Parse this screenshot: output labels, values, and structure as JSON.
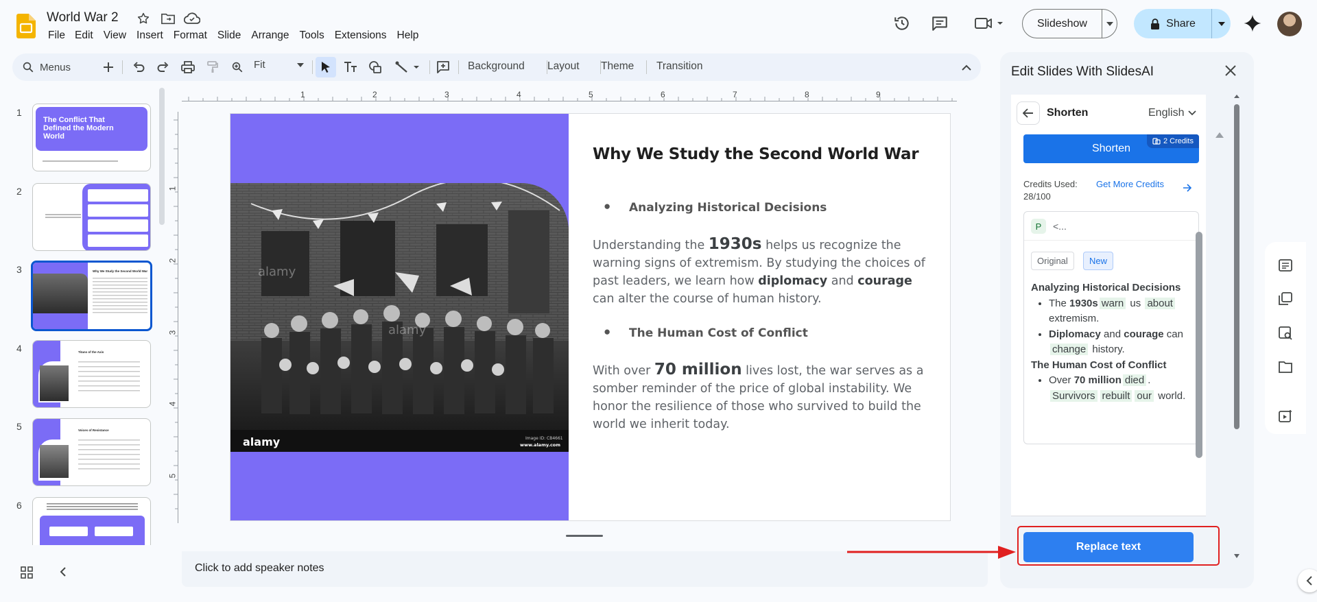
{
  "app": {
    "doc_title": "World War 2",
    "menu": [
      "File",
      "Edit",
      "View",
      "Insert",
      "Format",
      "Slide",
      "Arrange",
      "Tools",
      "Extensions",
      "Help"
    ],
    "slideshow_label": "Slideshow",
    "share_label": "Share"
  },
  "toolbar": {
    "search_label": "Menus",
    "zoom": "Fit",
    "background": "Background",
    "layout": "Layout",
    "theme": "Theme",
    "transition": "Transition"
  },
  "filmstrip": {
    "slides": [
      {
        "num": "1",
        "title": "The Conflict That Defined the Modern World"
      },
      {
        "num": "2",
        "title": ""
      },
      {
        "num": "3",
        "title": "Why We Study the Second World War"
      },
      {
        "num": "4",
        "title": "Titans of the Axis"
      },
      {
        "num": "5",
        "title": "Voices of Resistance"
      },
      {
        "num": "6",
        "title": ""
      }
    ],
    "selected_index": 2
  },
  "ruler": {
    "h_ticks": [
      "1",
      "2",
      "3",
      "4",
      "5",
      "6",
      "7",
      "8",
      "9"
    ],
    "v_ticks": [
      "1",
      "2",
      "3",
      "4",
      "5"
    ]
  },
  "slide": {
    "title": "Why We Study the Second World War",
    "bullet1": "Analyzing Historical Decisions",
    "para1": {
      "a": "Understanding the ",
      "b": "1930s",
      "c": " helps us recognize the warning signs of extremism. By studying the choices of past leaders, we learn how ",
      "d": "diplomacy",
      "e": " and ",
      "f": "courage",
      "g": " can alter the course of human history."
    },
    "bullet2": "The Human Cost of Conflict",
    "para2": {
      "a": "With over ",
      "b": "70 million",
      "c": " lives lost, the war serves as a somber reminder of the price of global instability. We honor the resilience of those who survived to build the world we inherit today."
    },
    "photo_watermark": "alamy",
    "photo_footer_logo": "alamy",
    "photo_footer_id": "Image ID: CB4661",
    "photo_footer_url": "www.alamy.com"
  },
  "notes_placeholder": "Click to add speaker notes",
  "side_panel": {
    "title": "Edit Slides With SlidesAI",
    "heading": "Shorten",
    "language": "English",
    "action_label": "Shorten",
    "credits_badge": "2 Credits",
    "credits_used_label": "Credits Used:",
    "credits_used_value": "28/100",
    "more_credits": "Get More Credits",
    "card_chip": "P",
    "card_preview": "<...",
    "tab_original": "Original",
    "tab_new": "New",
    "result": {
      "h1": "Analyzing Historical Decisions",
      "l1": {
        "a": "The ",
        "b": "1930s",
        "c": "warn",
        "d": " us ",
        "e": "about",
        "f": " extremism."
      },
      "l2": {
        "a": "Diplomacy",
        "b": " and ",
        "c": "courage",
        "d": " can ",
        "e": "change",
        "f": " history."
      },
      "h2": "The Human Cost of Conflict",
      "l3": {
        "a": "Over ",
        "b": "70 million",
        "c": "died",
        "d": ".",
        "e": "Survivors",
        "f": "rebuilt",
        "g": "our",
        "h": " world."
      }
    },
    "replace_label": "Replace text"
  },
  "colors": {
    "accent": "#7b6cf6",
    "primary_button": "#1a73e8",
    "share_bg": "#c2e7ff",
    "highlight_red": "#e02020"
  }
}
